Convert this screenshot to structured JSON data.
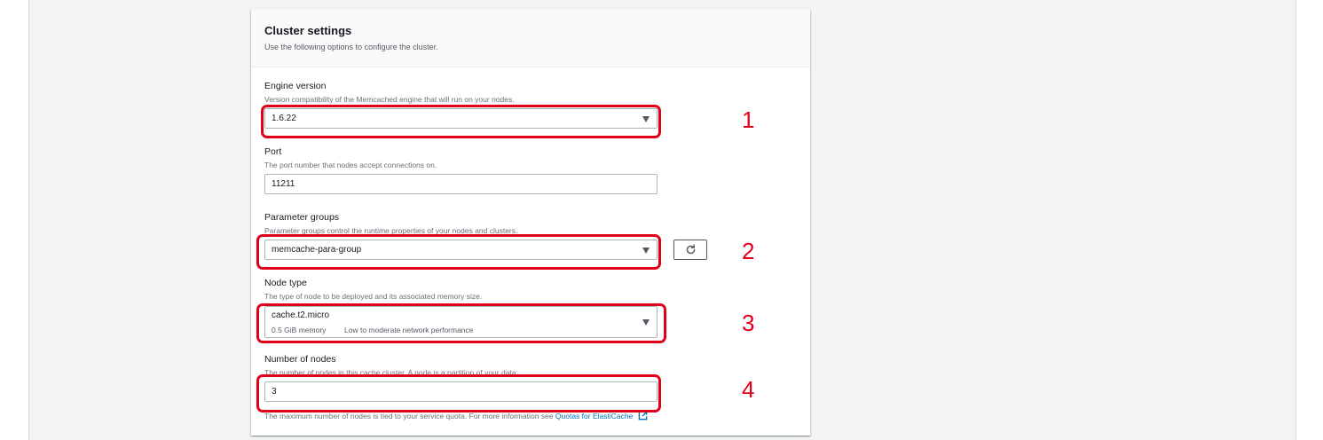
{
  "panel": {
    "title": "Cluster settings",
    "description": "Use the following options to configure the cluster."
  },
  "engine_version": {
    "label": "Engine version",
    "description": "Version compatibility of the Memcached engine that will run on your nodes.",
    "value": "1.6.22"
  },
  "port": {
    "label": "Port",
    "description": "The port number that nodes accept connections on.",
    "value": "11211"
  },
  "parameter_groups": {
    "label": "Parameter groups",
    "description": "Parameter groups control the runtime properties of your nodes and clusters.",
    "value": "memcache-para-group"
  },
  "node_type": {
    "label": "Node type",
    "description": "The type of node to be deployed and its associated memory size.",
    "value": "cache.t2.micro",
    "memory": "0.5 GiB memory",
    "network": "Low to moderate network performance"
  },
  "number_of_nodes": {
    "label": "Number of nodes",
    "description": "The number of nodes in this cache cluster. A node is a partition of your data.",
    "value": "3",
    "note": "The maximum number of nodes is tied to your service quota. For more information see",
    "note_link": "Quotas for ElastiCache"
  },
  "annotations": [
    "1",
    "2",
    "3",
    "4"
  ],
  "colors": {
    "highlight": "#e0001a",
    "link": "#0073bb"
  }
}
